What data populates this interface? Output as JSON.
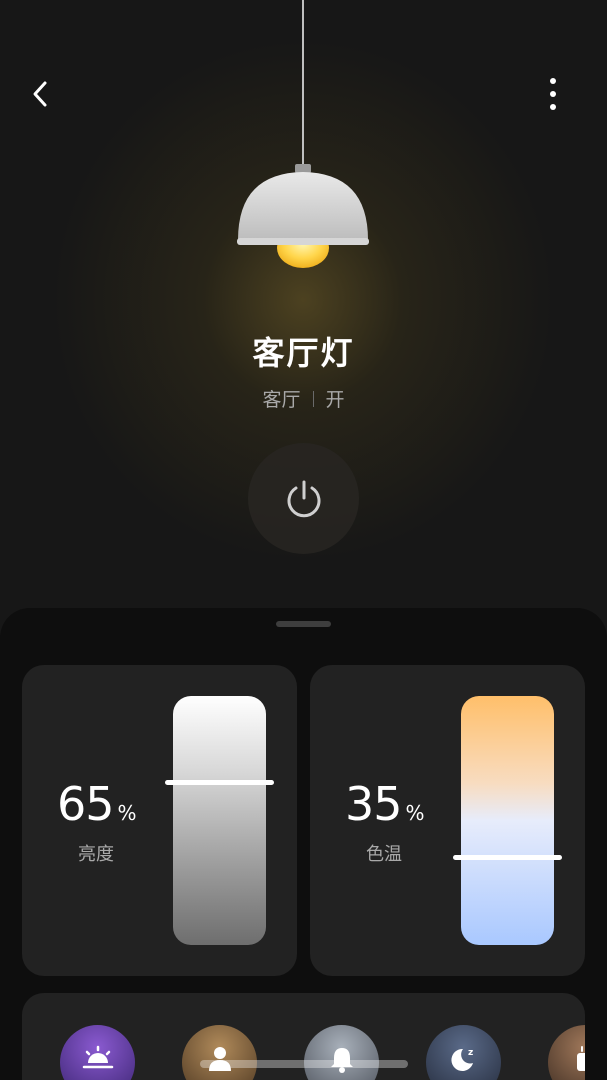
{
  "device": {
    "name": "客厅灯",
    "room": "客厅",
    "state": "开"
  },
  "controls": {
    "brightness": {
      "value": "65",
      "unit": "%",
      "label": "亮度",
      "level": 0.65
    },
    "color_temp": {
      "value": "35",
      "unit": "%",
      "label": "色温",
      "level": 0.35
    }
  },
  "scenes": [
    {
      "icon": "sunrise-icon"
    },
    {
      "icon": "person-icon"
    },
    {
      "icon": "bell-icon"
    },
    {
      "icon": "moon-sleep-icon"
    },
    {
      "icon": "coffee-icon"
    }
  ],
  "colors": {
    "accent_warm": "#ffbf6a",
    "accent_cool": "#a9c8ff",
    "bulb": "#ffd54a"
  }
}
